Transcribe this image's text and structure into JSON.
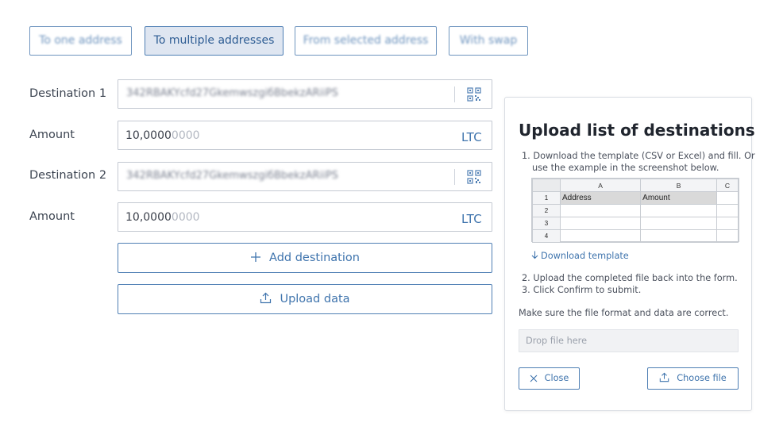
{
  "tabs": [
    {
      "label": "To one address",
      "active": false
    },
    {
      "label": "To multiple addresses",
      "active": true
    },
    {
      "label": "From selected address",
      "active": false
    },
    {
      "label": "With swap",
      "active": false
    }
  ],
  "form": {
    "destination1": {
      "label": "Destination 1",
      "value": "342RBAKYcfd27GkemwszgiбBbekzARiiPS"
    },
    "amount1": {
      "label": "Amount",
      "value": "10,0000",
      "placeholder_tail": "0000",
      "currency": "LTC"
    },
    "destination2": {
      "label": "Destination  2",
      "value": "342RBAKYcfd27GkemwszgiбBbekzARiiPS"
    },
    "amount2": {
      "label": "Amount",
      "value": "10,0000",
      "placeholder_tail": "0000",
      "currency": "LTC"
    },
    "add_destination_label": "Add destination",
    "upload_data_label": "Upload data"
  },
  "icons": {
    "qr": "qr-code-icon",
    "plus": "plus-icon",
    "upload": "upload-icon",
    "download": "download-arrow-icon",
    "close": "close-icon"
  },
  "panel": {
    "title": "Upload list of destinations",
    "step1_line1": "1. Download the template (CSV or Excel) and fill. Or",
    "step1_line2": "use the example in the screenshot below.",
    "sheet": {
      "columns": [
        "A",
        "B",
        "C"
      ],
      "rows": [
        {
          "num": "1",
          "cells": [
            "Address",
            "Amount",
            ""
          ]
        },
        {
          "num": "2",
          "cells": [
            "",
            "",
            ""
          ]
        },
        {
          "num": "3",
          "cells": [
            "",
            "",
            ""
          ]
        },
        {
          "num": "4",
          "cells": [
            "",
            "",
            ""
          ]
        }
      ]
    },
    "download_template": "Download template",
    "step2": "2. Upload the completed file back into the form.",
    "step3": "3. Click Confirm to submit.",
    "note": "Make sure the file format and data are correct.",
    "drop_placeholder": "Drop file here",
    "close_label": "Close",
    "choose_file_label": "Choose file"
  },
  "colors": {
    "accent": "#3f74ad",
    "border": "#c4c9d2",
    "active_tab_bg": "#dfe6f1"
  }
}
